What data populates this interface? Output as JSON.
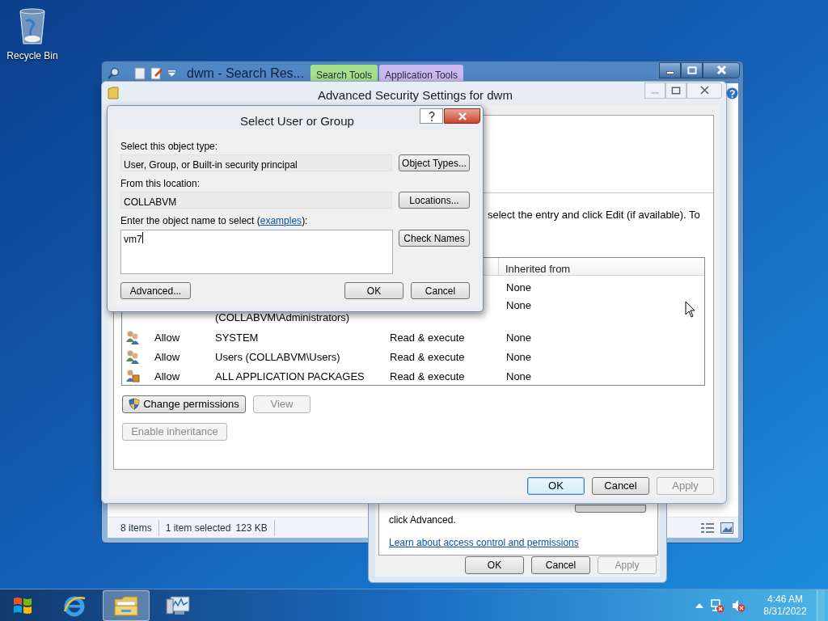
{
  "desktop_icons": [
    {
      "label": "Recycle Bin"
    }
  ],
  "explorer": {
    "title": "dwm - Search Res...",
    "ribbon_tabs": [
      {
        "label": "Search Tools",
        "color": "#a6e08c"
      },
      {
        "label": "Application Tools",
        "color": "#cdb8f2"
      }
    ],
    "status_sections": [
      [
        "8 items"
      ],
      [
        "1 item selected",
        "123 KB"
      ]
    ]
  },
  "properties": {
    "text": "click Advanced.",
    "link": "Learn about access control and permissions",
    "buttons": [
      {
        "label": "OK",
        "disabled": false
      },
      {
        "label": "Cancel",
        "disabled": false
      },
      {
        "label": "Apply",
        "disabled": true
      }
    ]
  },
  "advanced_security": {
    "title": "Advanced Security Settings for dwm",
    "instructions": "select the entry and click Edit (if available). To",
    "columns": [
      "Inherited from"
    ],
    "rows": [
      {
        "inherited": "None"
      },
      {
        "principal": "(COLLABVM\\Administrators)",
        "inherited": "None"
      },
      {
        "kind": "group",
        "type": "Allow",
        "principal": "SYSTEM",
        "access": "Read & execute",
        "inherited": "None"
      },
      {
        "kind": "group",
        "type": "Allow",
        "principal": "Users (COLLABVM\\Users)",
        "access": "Read & execute",
        "inherited": "None"
      },
      {
        "kind": "package",
        "type": "Allow",
        "principal": "ALL APPLICATION PACKAGES",
        "access": "Read & execute",
        "inherited": "None"
      }
    ],
    "action_buttons": [
      {
        "label": "Change permissions",
        "disabled": false,
        "kind": "shield"
      },
      {
        "label": "View",
        "disabled": true,
        "kind": "plain"
      }
    ],
    "inheritance_button": {
      "label": "Enable inheritance",
      "disabled": true
    },
    "footer_buttons": [
      {
        "label": "OK",
        "disabled": false,
        "focused": true
      },
      {
        "label": "Cancel",
        "disabled": false,
        "focused": false
      },
      {
        "label": "Apply",
        "disabled": true,
        "focused": false
      }
    ]
  },
  "select_dialog": {
    "title": "Select User or Group",
    "fields": [
      {
        "label": "Select this object type:",
        "value": "User, Group, or Built-in security principal",
        "button": "Object Types..."
      },
      {
        "label": "From this location:",
        "value": "COLLABVM",
        "button": "Locations..."
      }
    ],
    "name_label": "Enter the object name to select (",
    "name_link": "examples",
    "name_label_end": "):",
    "name_value": "vm7",
    "check_button": "Check Names",
    "advanced_button": "Advanced...",
    "buttons": [
      "OK",
      "Cancel"
    ]
  },
  "taskbar": {
    "apps": [
      {
        "kind": "browser",
        "selected": false
      },
      {
        "kind": "folder",
        "selected": true
      },
      {
        "kind": "monitor",
        "selected": false
      }
    ],
    "time": "4:46 AM",
    "date": "8/31/2022"
  }
}
